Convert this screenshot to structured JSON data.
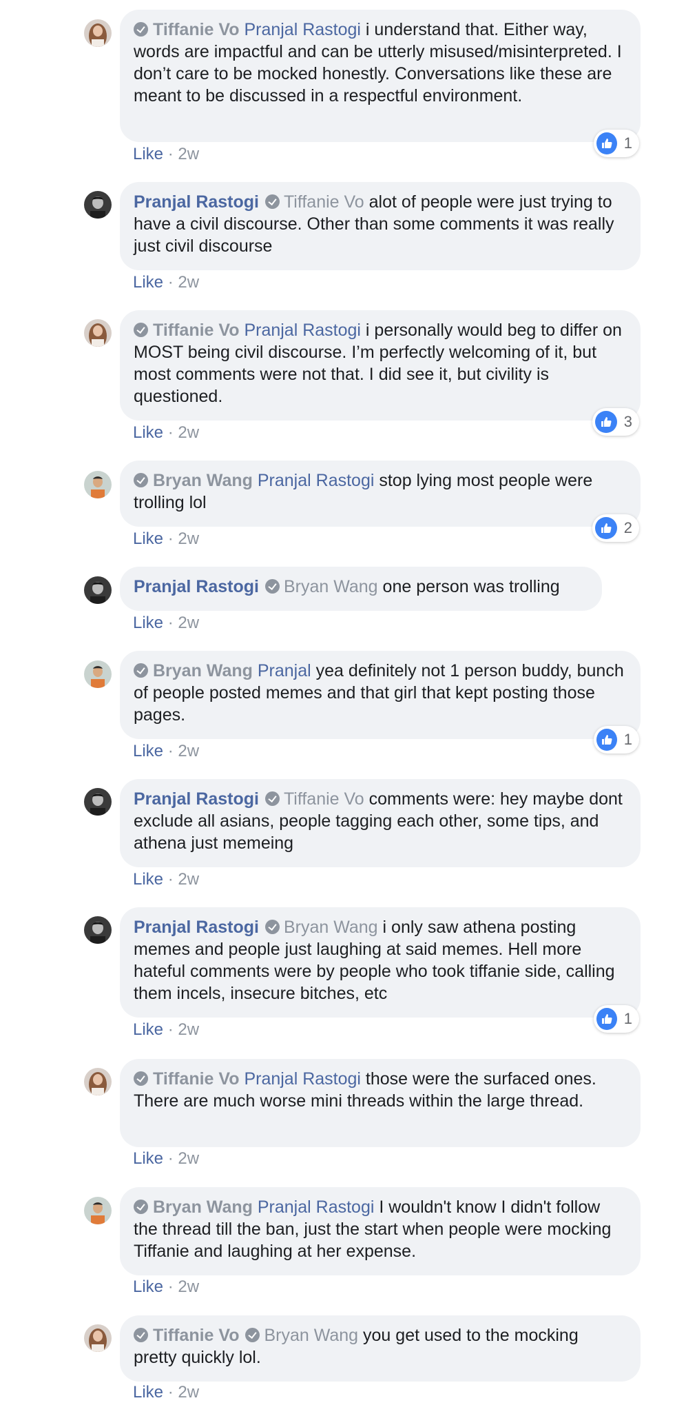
{
  "meta_sep": " · ",
  "comments": [
    {
      "author": "Tiffanie Vo",
      "mention": "Pranjal Rastogi",
      "text": "i understand that. Either way, words are impactful and can be utterly misused/misinterpreted. I don’t care to be mocked honestly. Conversations like these are meant to be discussed in a respectful environment.",
      "like_label": "Like",
      "time": "2w",
      "reactions": "1"
    },
    {
      "author": "Pranjal Rastogi",
      "mention": "Tiffanie Vo",
      "text": "alot of people were just trying to have a civil discourse. Other than some comments it was really just civil discourse",
      "like_label": "Like",
      "time": "2w"
    },
    {
      "author": "Tiffanie Vo",
      "mention": "Pranjal Rastogi",
      "text": "i personally would beg to differ on MOST being civil discourse. I’m perfectly welcoming of it, but most comments were not that. I did see it, but civility is questioned.",
      "like_label": "Like",
      "time": "2w",
      "reactions": "3"
    },
    {
      "author": "Bryan Wang",
      "mention": "Pranjal Rastogi",
      "text": "stop lying most people were trolling lol",
      "like_label": "Like",
      "time": "2w",
      "reactions": "2"
    },
    {
      "author": "Pranjal Rastogi",
      "mention": "Bryan Wang",
      "text": "one person was trolling",
      "like_label": "Like",
      "time": "2w"
    },
    {
      "author": "Bryan Wang",
      "mention": "Pranjal",
      "text": "yea definitely not 1 person buddy, bunch of people posted memes and that girl that kept posting those pages.",
      "like_label": "Like",
      "time": "2w",
      "reactions": "1"
    },
    {
      "author": "Pranjal Rastogi",
      "mention": "Tiffanie Vo",
      "text": "comments were: hey maybe dont exclude all asians, people tagging each other, some tips, and athena just memeing",
      "like_label": "Like",
      "time": "2w"
    },
    {
      "author": "Pranjal Rastogi",
      "mention": "Bryan Wang",
      "text": "i only saw athena posting memes and people just laughing at said memes. Hell more hateful comments were by people who took tiffanie side, calling them incels, insecure bitches, etc",
      "like_label": "Like",
      "time": "2w",
      "reactions": "1"
    },
    {
      "author": "Tiffanie Vo",
      "mention": "Pranjal Rastogi",
      "text": "those were the surfaced ones. There are much worse mini threads within the large thread.",
      "like_label": "Like",
      "time": "2w"
    },
    {
      "author": "Bryan Wang",
      "mention": "Pranjal Rastogi",
      "text": "I wouldn't know I didn't follow the thread till the ban, just the start when people were mocking Tiffanie and laughing at her expense.",
      "like_label": "Like",
      "time": "2w"
    },
    {
      "author": "Tiffanie Vo",
      "mention": "Bryan Wang",
      "text": "you get used to the mocking pretty quickly lol.",
      "like_label": "Like",
      "time": "2w"
    }
  ]
}
